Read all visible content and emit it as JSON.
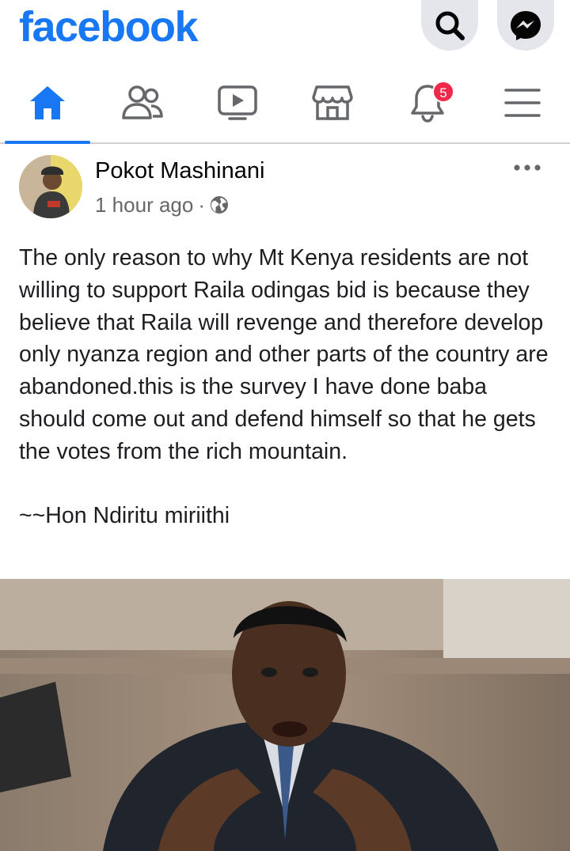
{
  "app": {
    "logo_text": "facebook",
    "brand_color": "#1877f2"
  },
  "header": {
    "buttons": [
      {
        "name": "search",
        "icon": "search-icon"
      },
      {
        "name": "messenger",
        "icon": "messenger-icon"
      }
    ]
  },
  "nav": {
    "tabs": [
      {
        "name": "home",
        "icon": "home-icon",
        "active": true
      },
      {
        "name": "friends",
        "icon": "friends-icon",
        "active": false
      },
      {
        "name": "watch",
        "icon": "video-icon",
        "active": false
      },
      {
        "name": "marketplace",
        "icon": "store-icon",
        "active": false
      },
      {
        "name": "notifications",
        "icon": "bell-icon",
        "active": false,
        "badge": "5"
      },
      {
        "name": "menu",
        "icon": "hamburger-icon",
        "active": false
      }
    ]
  },
  "post": {
    "author": "Pokot Mashinani",
    "time": "1 hour ago",
    "separator": "·",
    "privacy_icon": "globe-icon",
    "more_icon": "more-dots-icon",
    "body": "The only reason to why Mt Kenya residents are not willing to support Raila odingas bid is because they believe that Raila will revenge and therefore develop only nyanza region and other parts of the country are abandoned.this is the survey I have done baba should come out and defend himself so that he gets the votes from the rich mountain.\n\n~~Hon Ndiritu miriithi",
    "image_icon": "post-photo"
  }
}
